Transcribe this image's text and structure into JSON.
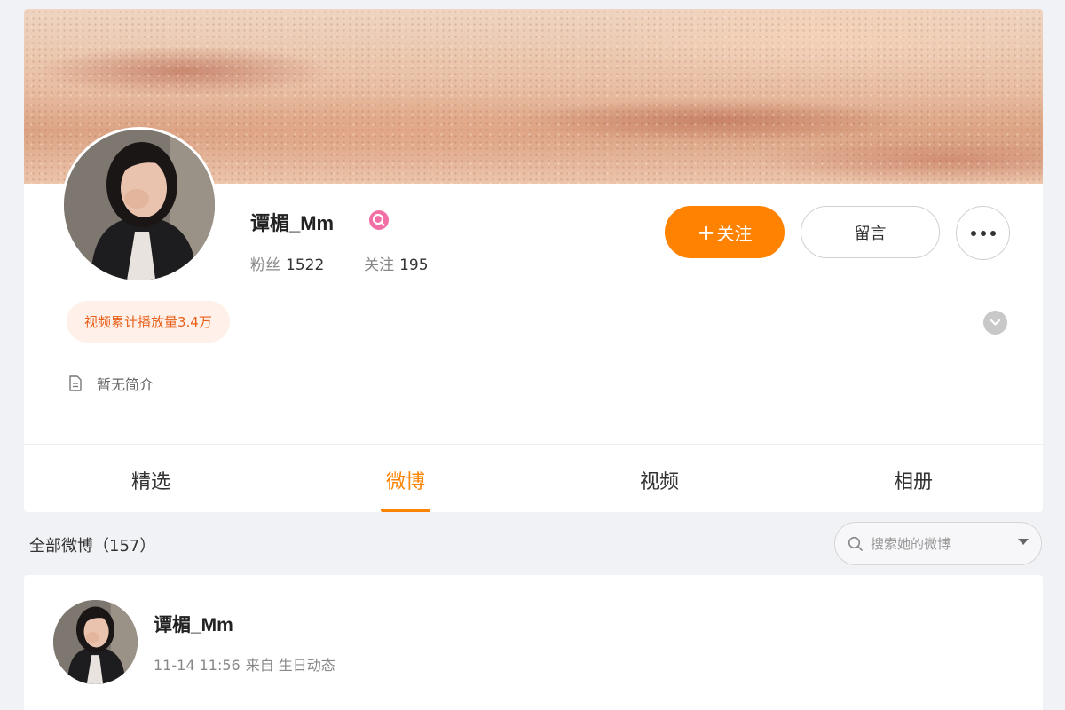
{
  "profile": {
    "name": "谭楣_Mm",
    "fans_label": "粉丝",
    "fans_count": "1522",
    "following_label": "关注",
    "following_count": "195",
    "follow_button_label": "关注",
    "message_button_label": "留言",
    "play_badge": "视频累计播放量3.4万",
    "bio": "暂无简介"
  },
  "tabs": [
    {
      "label": "精选",
      "active": false
    },
    {
      "label": "微博",
      "active": true
    },
    {
      "label": "视频",
      "active": false
    },
    {
      "label": "相册",
      "active": false
    }
  ],
  "feed": {
    "count_label": "全部微博（157）",
    "search_placeholder": "搜索她的微博"
  },
  "post": {
    "author": "谭楣_Mm",
    "time": "11-14 11:56",
    "source": "来自 生日动态"
  },
  "colors": {
    "accent": "#ff8200",
    "badge_pink": "#f26ea5",
    "play_badge_bg": "#fff1ea",
    "play_badge_text": "#e85f19"
  },
  "icons": {
    "verified": "verified-badge-icon",
    "more": "more-dots-icon",
    "expand": "chevron-down-icon",
    "bio": "document-icon",
    "search": "search-icon",
    "dropdown": "caret-down-icon"
  }
}
